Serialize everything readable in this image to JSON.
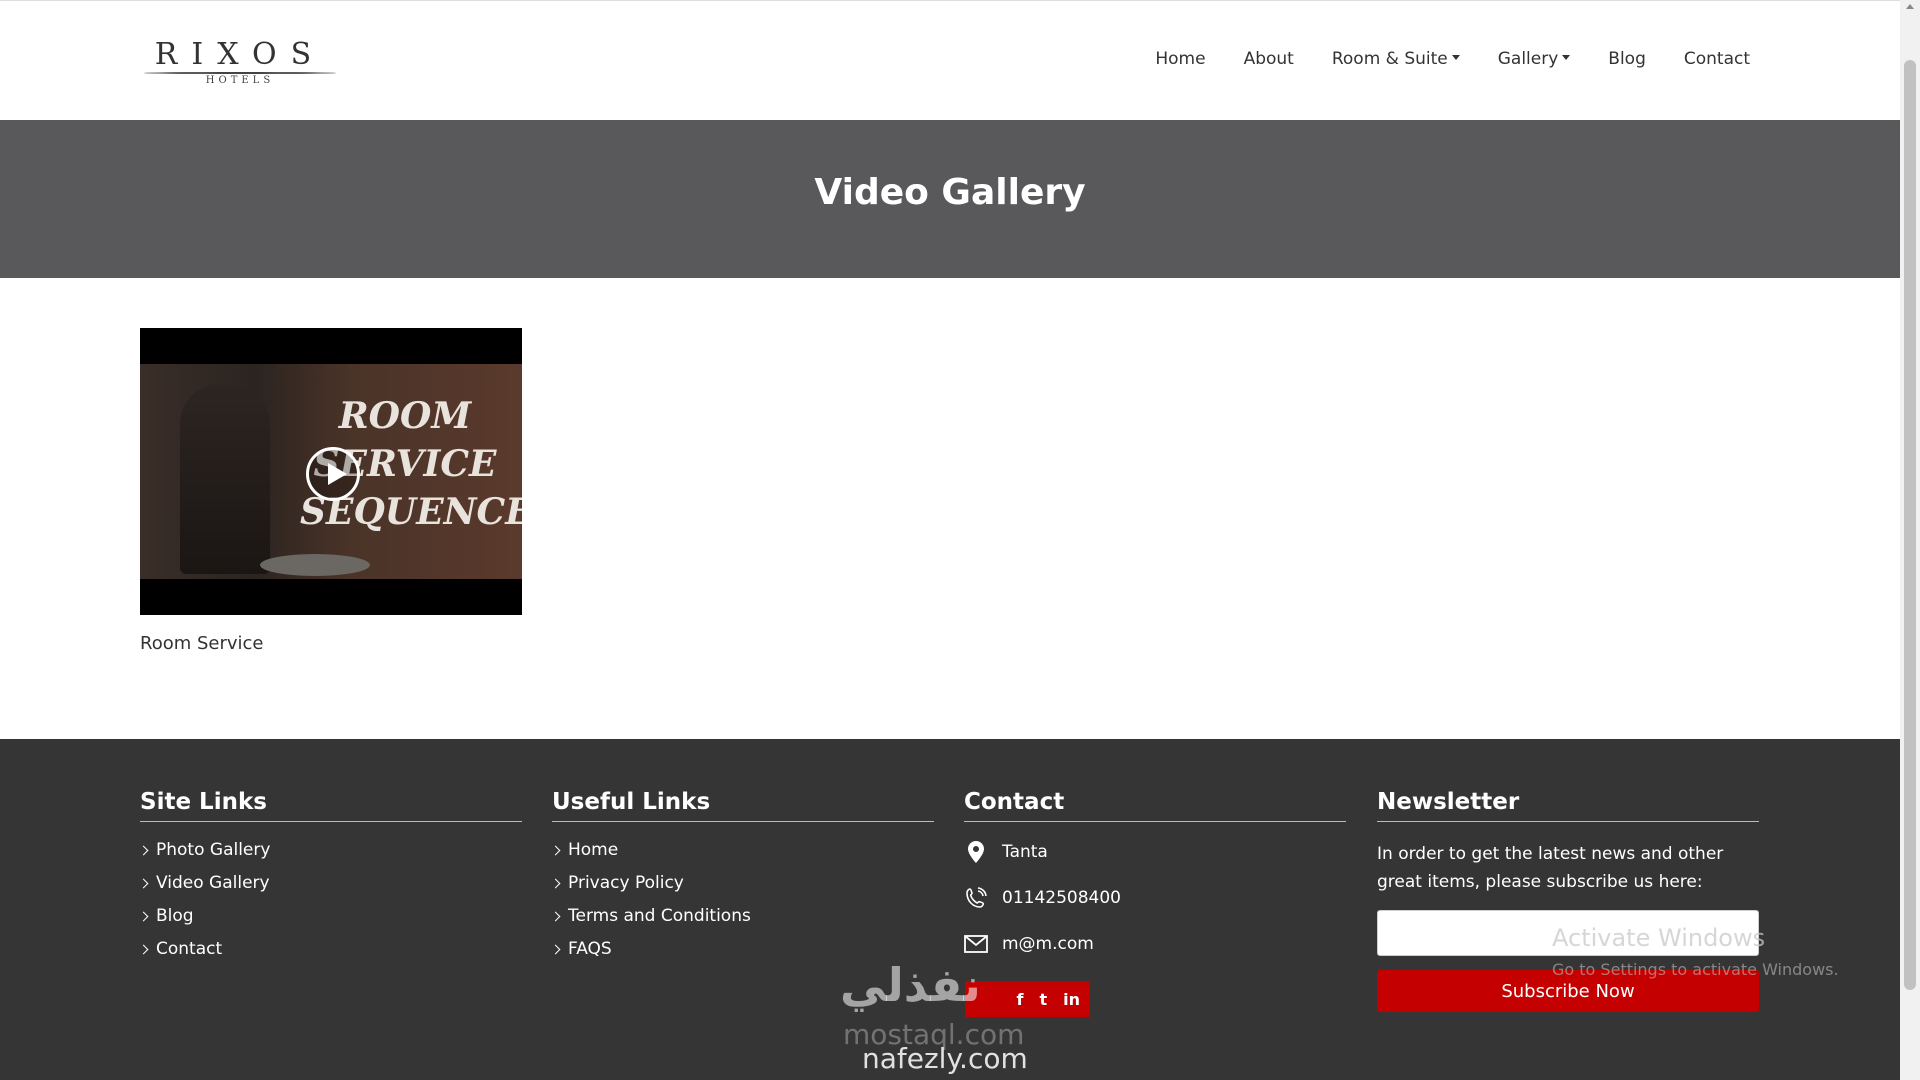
{
  "header": {
    "logo": {
      "word": "RIXOS",
      "sub": "HOTELS"
    },
    "nav": [
      {
        "label": "Home",
        "dropdown": false
      },
      {
        "label": "About",
        "dropdown": false
      },
      {
        "label": "Room & Suite",
        "dropdown": true
      },
      {
        "label": "Gallery",
        "dropdown": true
      },
      {
        "label": "Blog",
        "dropdown": false
      },
      {
        "label": "Contact",
        "dropdown": false
      }
    ]
  },
  "banner": {
    "title": "Video Gallery"
  },
  "videos": [
    {
      "caption": "Room Service",
      "thumbnail_text": "ROOM SERVICE SEQUENCE"
    }
  ],
  "footer": {
    "site_links": {
      "title": "Site Links",
      "items": [
        "Photo Gallery",
        "Video Gallery",
        "Blog",
        "Contact"
      ]
    },
    "useful_links": {
      "title": "Useful Links",
      "items": [
        "Home",
        "Privacy Policy",
        "Terms and Conditions",
        "FAQS"
      ]
    },
    "contact": {
      "title": "Contact",
      "location": "Tanta",
      "phone": "01142508400",
      "email": "m@m.com",
      "social": [
        "f",
        "t",
        "in"
      ]
    },
    "newsletter": {
      "title": "Newsletter",
      "text": "In order to get the latest news and other great items, please subscribe us here:",
      "placeholder": "",
      "button": "Subscribe Now"
    }
  },
  "overlay": {
    "activate_title": "Activate Windows",
    "activate_sub": "Go to Settings to activate Windows.",
    "watermark": [
      "نفذلي",
      "mostaql.com",
      "nafezly.com"
    ]
  },
  "colors": {
    "accent": "#c40000",
    "banner": "#59585a",
    "footer": "#363536"
  }
}
